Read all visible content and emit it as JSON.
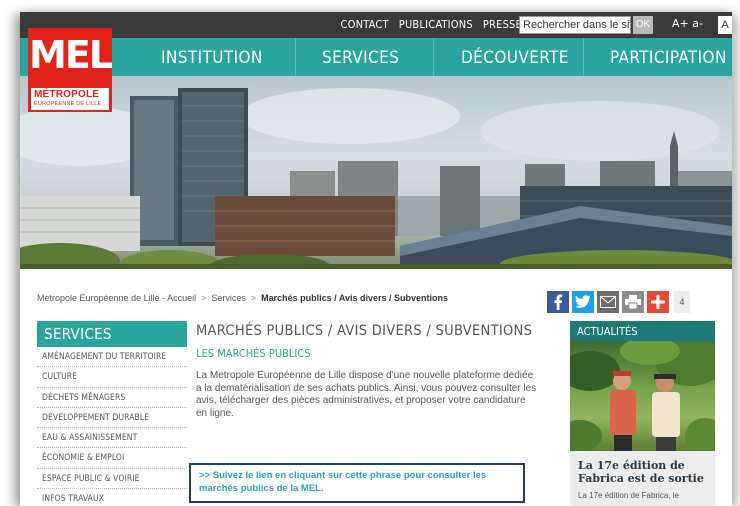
{
  "topbar": {
    "links": [
      "CONTACT",
      "PUBLICATIONS",
      "PRESSE"
    ],
    "search_value": "Rechercher dans le site",
    "ok_label": "OK",
    "font_controls": "A+ a-",
    "font_box": "A"
  },
  "logo": {
    "main": "MEL",
    "line1": "MÉTROPOLE",
    "line2": "EUROPÉENNE DE LILLE"
  },
  "mainnav": {
    "items": [
      "INSTITUTION",
      "SERVICES",
      "DÉCOUVERTE",
      "PARTICIPATION"
    ]
  },
  "breadcrumb": {
    "home": "Metropole Européenne de Lille - Accueil",
    "level1": "Services",
    "current": "Marchés publics / Avis divers / Subventions",
    "separator": ">"
  },
  "share": {
    "count": "4",
    "colors": {
      "facebook": "#3b5998",
      "twitter": "#1da1f2",
      "mail": "#6d6d6d",
      "print": "#8c8c8c",
      "plus": "#e94a35"
    }
  },
  "sidebar": {
    "title": "SERVICES",
    "items": [
      "AMÉNAGEMENT DU TERRITOIRE",
      "CULTURE",
      "DÉCHETS MÉNAGERS",
      "DÉVELOPPEMENT DURABLE",
      "EAU & ASSAINISSEMENT",
      "ÉCONOMIE & EMPLOI",
      "ESPACE PUBLIC & VOIRIE",
      "INFOS TRAVAUX"
    ]
  },
  "content": {
    "title": "MARCHÉS PUBLICS / AVIS DIVERS / SUBVENTIONS",
    "subtitle": "LES MARCHÉS PUBLICS",
    "paragraph": "La Metropole Européenne de Lille dispose d'une nouvelle plateforme dediée a la dematérialisation de ses achats publics. Ainsi, vous pouvez consulter les avis, télécharger des pièces administratives, et proposer votre candidature en ligne.",
    "link_text": ">> Suivez le lien en cliquant sur cette phrase pour consulter les marchés publics de la MEL."
  },
  "actu": {
    "heading": "ACTUALITÉS",
    "caption": "La 17e édition de Fabrica est de sortie",
    "excerpt": "La 17e édition de Fabrica, le"
  },
  "colors": {
    "teal": "#2aa59e",
    "dark_teal": "#1d7a76",
    "logo_red": "#e1231a",
    "topbar": "#3a3a3a"
  }
}
